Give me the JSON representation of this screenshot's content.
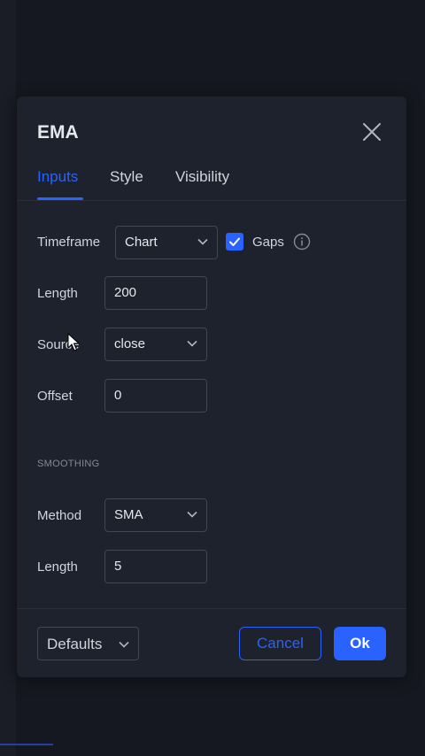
{
  "dialog": {
    "title": "EMA",
    "tabs": [
      {
        "label": "Inputs",
        "active": true
      },
      {
        "label": "Style",
        "active": false
      },
      {
        "label": "Visibility",
        "active": false
      }
    ]
  },
  "inputs": {
    "timeframe": {
      "label": "Timeframe",
      "value": "Chart"
    },
    "gaps": {
      "label": "Gaps",
      "checked": true
    },
    "length": {
      "label": "Length",
      "value": "200"
    },
    "source": {
      "label": "Source",
      "value": "close"
    },
    "offset": {
      "label": "Offset",
      "value": "0"
    }
  },
  "smoothing": {
    "section_label": "SMOOTHING",
    "method": {
      "label": "Method",
      "value": "SMA"
    },
    "length": {
      "label": "Length",
      "value": "5"
    }
  },
  "footer": {
    "defaults_label": "Defaults",
    "cancel_label": "Cancel",
    "ok_label": "Ok"
  },
  "colors": {
    "accent": "#2962ff",
    "dialog_bg": "#1e222d",
    "page_bg": "#161821"
  },
  "icons": {
    "close": "close-icon",
    "chevron": "chevron-down-icon",
    "check": "checkmark-icon",
    "info": "info-icon",
    "cursor": "mouse-cursor-icon"
  }
}
